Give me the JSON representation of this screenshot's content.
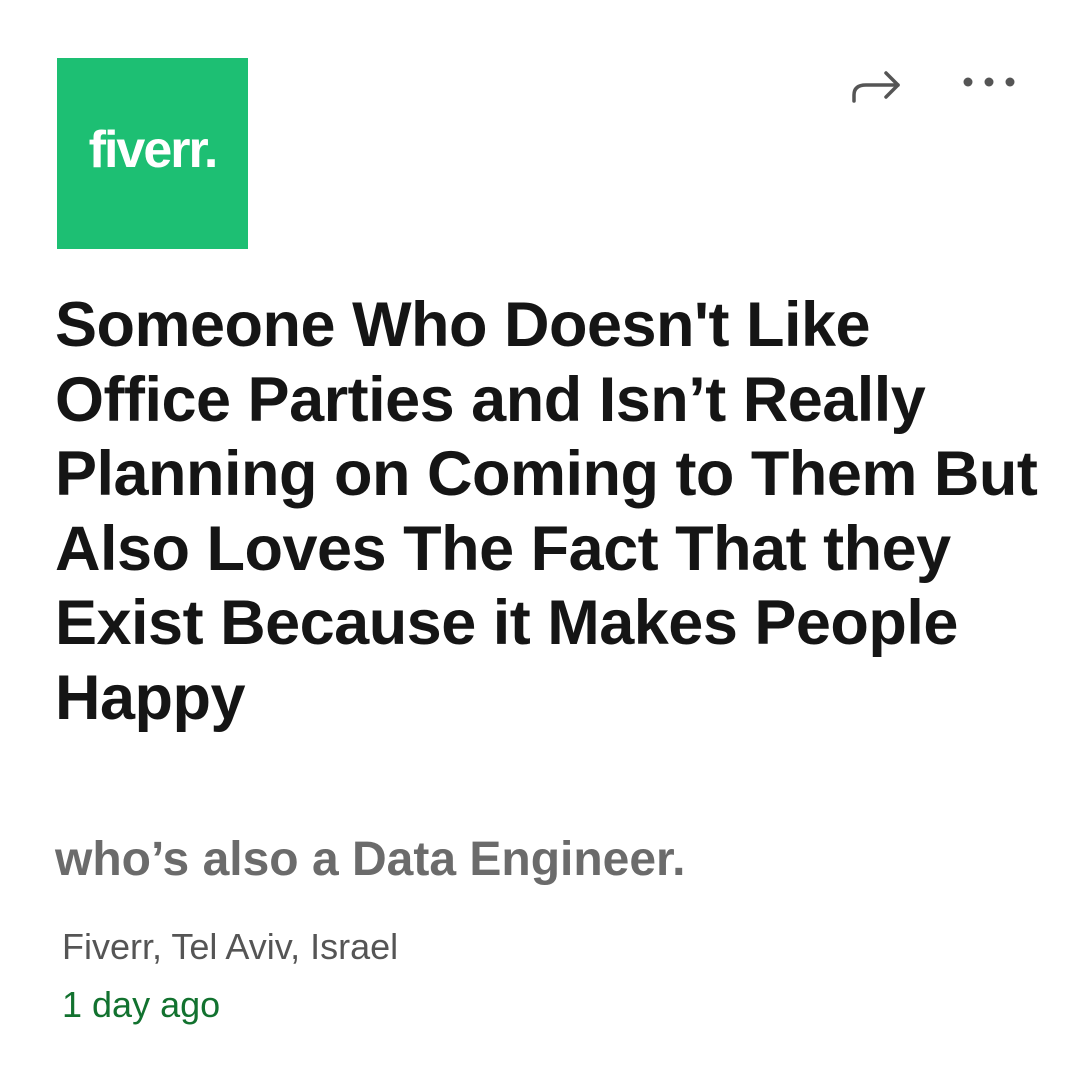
{
  "logo": {
    "text": "fiverr.",
    "brand_color": "#1dbf73"
  },
  "actions": {
    "share_icon": "share-arrow-icon",
    "more_icon": "more-horizontal-icon"
  },
  "job": {
    "title": "Someone Who Doesn't Like Office Parties and Isn’t Really Planning on Coming to Them But Also Loves The Fact That they Exist Because it Makes People Happy",
    "subtitle": "who’s also a Data Engineer.",
    "location": "Fiverr, Tel Aviv, Israel",
    "posted": "1 day ago"
  },
  "colors": {
    "title": "#151515",
    "subtitle": "#6b6b6b",
    "meta": "#555555",
    "posted": "#12722f"
  }
}
